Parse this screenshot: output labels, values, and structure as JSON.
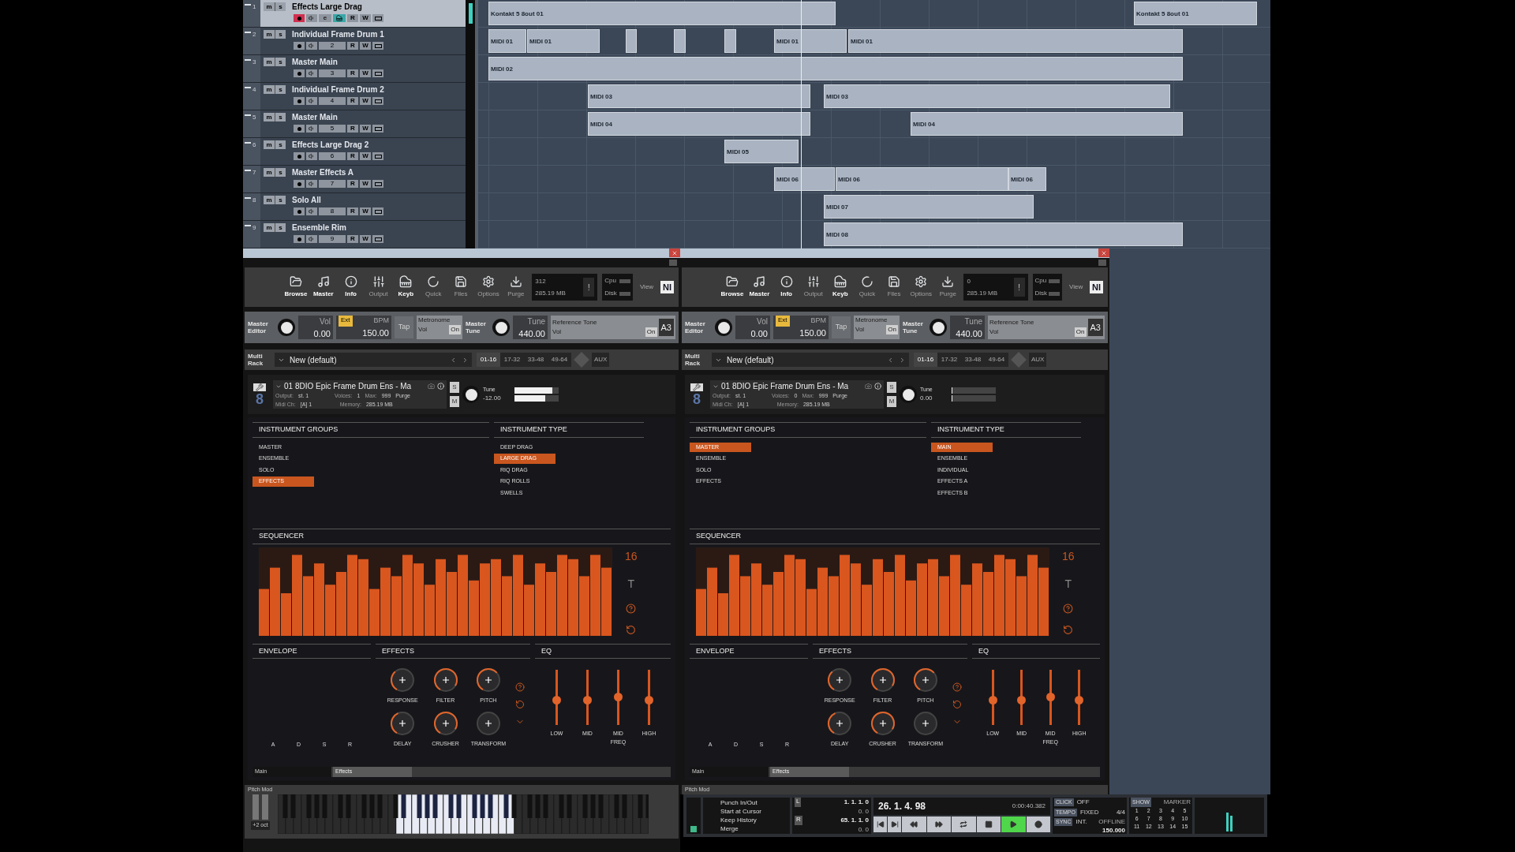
{
  "tracks": [
    {
      "number": "1",
      "name": "Effects Large Drag",
      "selected": true,
      "record": true,
      "kind": "instrument",
      "mute": "m",
      "solo": "s",
      "edit": "e",
      "read": "R",
      "write": "W"
    },
    {
      "number": "2",
      "name": "Individual Frame Drum 1",
      "selected": false,
      "record": false,
      "kind": "midi",
      "channel": "2",
      "mute": "m",
      "solo": "s",
      "read": "R",
      "write": "W"
    },
    {
      "number": "3",
      "name": "Master Main",
      "selected": false,
      "record": false,
      "kind": "midi",
      "channel": "3",
      "mute": "m",
      "solo": "s",
      "read": "R",
      "write": "W"
    },
    {
      "number": "4",
      "name": "Individual Frame Drum 2",
      "selected": false,
      "record": false,
      "kind": "midi",
      "channel": "4",
      "mute": "m",
      "solo": "s",
      "read": "R",
      "write": "W"
    },
    {
      "number": "5",
      "name": "Master Main",
      "selected": false,
      "record": false,
      "kind": "midi",
      "channel": "5",
      "mute": "m",
      "solo": "s",
      "read": "R",
      "write": "W"
    },
    {
      "number": "6",
      "name": "Effects Large Drag 2",
      "selected": false,
      "record": false,
      "kind": "midi",
      "channel": "6",
      "mute": "m",
      "solo": "s",
      "read": "R",
      "write": "W"
    },
    {
      "number": "7",
      "name": "Master Effects A",
      "selected": false,
      "record": false,
      "kind": "midi",
      "channel": "7",
      "mute": "m",
      "solo": "s",
      "read": "R",
      "write": "W"
    },
    {
      "number": "8",
      "name": "Solo All",
      "selected": false,
      "record": false,
      "kind": "midi",
      "channel": "8",
      "mute": "m",
      "solo": "s",
      "read": "R",
      "write": "W"
    },
    {
      "number": "9",
      "name": "Ensemble Rim",
      "selected": false,
      "record": false,
      "kind": "midi",
      "channel": "9",
      "mute": "m",
      "solo": "s",
      "read": "R",
      "write": "W"
    }
  ],
  "lanes": [
    {
      "clips": [
        {
          "kind": "named",
          "name": "Kontakt 5 8out 01"
        },
        {
          "kind": "named",
          "name": "Kontakt 5 8out 01"
        }
      ]
    },
    {
      "clips": [
        {
          "kind": "named",
          "name": "MIDI 01"
        },
        {
          "kind": "named",
          "name": "MIDI 01"
        },
        {
          "kind": "small"
        },
        {
          "kind": "small"
        },
        {
          "kind": "small"
        },
        {
          "kind": "named",
          "name": "MIDI 01"
        },
        {
          "kind": "named",
          "name": "MIDI 01"
        }
      ]
    },
    {
      "clips": [
        {
          "kind": "named",
          "name": "MIDI 02"
        }
      ]
    },
    {
      "clips": [
        {
          "kind": "named",
          "name": "MIDI 03"
        },
        {
          "kind": "named",
          "name": "MIDI 03"
        }
      ]
    },
    {
      "clips": [
        {
          "kind": "named",
          "name": "MIDI 04"
        },
        {
          "kind": "named",
          "name": "MIDI 04"
        }
      ]
    },
    {
      "clips": [
        {
          "kind": "named",
          "name": "MIDI 05"
        }
      ]
    },
    {
      "clips": [
        {
          "kind": "named",
          "name": "MIDI 06"
        },
        {
          "kind": "named",
          "name": "MIDI 06"
        },
        {
          "kind": "named",
          "name": "MIDI 06"
        }
      ]
    },
    {
      "clips": [
        {
          "kind": "named",
          "name": "MIDI 07"
        }
      ]
    },
    {
      "clips": [
        {
          "kind": "named",
          "name": "MIDI 08"
        }
      ]
    }
  ],
  "kontakt_windows": [
    {
      "toolbar": [
        {
          "label": "Browse",
          "kind": "folder",
          "disabled": false
        },
        {
          "label": "Master",
          "kind": "master",
          "disabled": false
        },
        {
          "label": "Info",
          "kind": "info",
          "disabled": false
        },
        {
          "label": "Output",
          "kind": "output",
          "disabled": true
        },
        {
          "label": "Keyb",
          "kind": "keyboard",
          "disabled": false
        },
        {
          "label": "Quick",
          "kind": "quick",
          "disabled": true
        },
        {
          "label": "Files",
          "kind": "files",
          "disabled": true
        },
        {
          "label": "Options",
          "kind": "options",
          "disabled": true
        },
        {
          "label": "Purge",
          "kind": "purge",
          "disabled": true
        }
      ],
      "status": {
        "voices": "312",
        "memory": "285.19 MB",
        "alert": "!"
      },
      "cpu": "Cpu",
      "disk": "Disk",
      "view": "View",
      "logo": "NI",
      "master": {
        "editor": "Master Editor",
        "vol_label": "Vol",
        "vol": "0.00",
        "ext": "Ext",
        "bpm_label": "BPM",
        "bpm": "150.00",
        "tap": "Tap",
        "metronome": "Metronome",
        "metro_on": "On",
        "metro_vol": "Vol",
        "tune_section": "Master Tune",
        "tune_label": "Tune",
        "tune": "440.00",
        "ref_tone": "Reference Tone",
        "ref_vol": "Vol",
        "ref_on": "On",
        "ref_note": "A3"
      },
      "rack": {
        "label": "Multi Rack",
        "preset": "New (default)",
        "pages": [
          {
            "label": "01-16",
            "selected": true
          },
          {
            "label": "17-32",
            "selected": false
          },
          {
            "label": "33-48",
            "selected": false
          },
          {
            "label": "49-64",
            "selected": false
          }
        ],
        "aux": "AUX"
      },
      "instrument": {
        "slot": "8",
        "name": "01 8DIO Epic Frame Drum Ens - Ma",
        "output_label": "Output:",
        "output": "st. 1",
        "voices_label": "Voices:",
        "voices": "1",
        "max_label": "Max:",
        "max": "999",
        "purge": "Purge",
        "midi_label": "Midi Ch:",
        "midi": "[A] 1",
        "memory_label": "Memory:",
        "memory": "285.19 MB",
        "solo": "S",
        "mute": "M",
        "tune_label": "Tune",
        "tune": "-12.00",
        "meters": [
          {
            "level": 0.85
          },
          {
            "level": 0.7
          }
        ]
      },
      "groups": {
        "title": "INSTRUMENT GROUPS",
        "items": [
          {
            "label": "MASTER",
            "selected": false
          },
          {
            "label": "ENSEMBLE",
            "selected": false
          },
          {
            "label": "SOLO",
            "selected": false
          },
          {
            "label": "EFFECTS",
            "selected": true
          }
        ]
      },
      "types": {
        "title": "INSTRUMENT TYPE",
        "items": [
          {
            "label": "DEEP DRAG",
            "selected": false
          },
          {
            "label": "LARGE DRAG",
            "selected": true
          },
          {
            "label": "RIQ DRAG",
            "selected": false
          },
          {
            "label": "RIQ ROLLS",
            "selected": false
          },
          {
            "label": "SWELLS",
            "selected": false
          }
        ]
      },
      "sequencer": {
        "title": "SEQUENCER",
        "steps": "16",
        "mode": "T"
      },
      "envelope": {
        "title": "ENVELOPE",
        "labels": [
          "A",
          "D",
          "S",
          "R"
        ]
      },
      "effects": {
        "title": "EFFECTS",
        "knobs": [
          {
            "label": "RESPONSE"
          },
          {
            "label": "FILTER"
          },
          {
            "label": "PITCH"
          },
          {
            "label": "DELAY"
          },
          {
            "label": "CRUSHER"
          },
          {
            "label": "TRANSFORM"
          }
        ]
      },
      "eq": {
        "title": "EQ",
        "bands": [
          {
            "label": "LOW",
            "level": 0.45
          },
          {
            "label": "MID",
            "level": 0.45
          },
          {
            "label": "MID FREQ",
            "level": 0.5
          },
          {
            "label": "HIGH",
            "level": 0.45
          }
        ]
      },
      "tabs": [
        {
          "label": "Main",
          "selected": true
        },
        {
          "label": "Effects",
          "selected": false
        }
      ],
      "keyboard": {
        "label": "Pitch Mod",
        "octave": "+2 oct"
      }
    },
    {
      "toolbar": [
        {
          "label": "Browse",
          "kind": "folder",
          "disabled": false
        },
        {
          "label": "Master",
          "kind": "master",
          "disabled": false
        },
        {
          "label": "Info",
          "kind": "info",
          "disabled": false
        },
        {
          "label": "Output",
          "kind": "output",
          "disabled": true
        },
        {
          "label": "Keyb",
          "kind": "keyboard",
          "disabled": false
        },
        {
          "label": "Quick",
          "kind": "quick",
          "disabled": true
        },
        {
          "label": "Files",
          "kind": "files",
          "disabled": true
        },
        {
          "label": "Options",
          "kind": "options",
          "disabled": true
        },
        {
          "label": "Purge",
          "kind": "purge",
          "disabled": true
        }
      ],
      "status": {
        "voices": "0",
        "memory": "285.19 MB",
        "alert": "!"
      },
      "cpu": "Cpu",
      "disk": "Disk",
      "view": "View",
      "logo": "NI",
      "master": {
        "editor": "Master Editor",
        "vol_label": "Vol",
        "vol": "0.00",
        "ext": "Ext",
        "bpm_label": "BPM",
        "bpm": "150.00",
        "tap": "Tap",
        "metronome": "Metronome",
        "metro_on": "On",
        "metro_vol": "Vol",
        "tune_section": "Master Tune",
        "tune_label": "Tune",
        "tune": "440.00",
        "ref_tone": "Reference Tone",
        "ref_vol": "Vol",
        "ref_on": "On",
        "ref_note": "A3"
      },
      "rack": {
        "label": "Multi Rack",
        "preset": "New (default)",
        "pages": [
          {
            "label": "01-16",
            "selected": true
          },
          {
            "label": "17-32",
            "selected": false
          },
          {
            "label": "33-48",
            "selected": false
          },
          {
            "label": "49-64",
            "selected": false
          }
        ],
        "aux": "AUX"
      },
      "instrument": {
        "slot": "8",
        "name": "01 8DIO Epic Frame Drum Ens - Ma",
        "output_label": "Output:",
        "output": "st. 1",
        "voices_label": "Voices:",
        "voices": "0",
        "max_label": "Max:",
        "max": "999",
        "purge": "Purge",
        "midi_label": "Midi Ch:",
        "midi": "[A] 1",
        "memory_label": "Memory:",
        "memory": "285.19 MB",
        "solo": "S",
        "mute": "M",
        "tune_label": "Tune",
        "tune": "0.00",
        "meters": [
          {
            "level": 0
          },
          {
            "level": 0
          }
        ]
      },
      "groups": {
        "title": "INSTRUMENT GROUPS",
        "items": [
          {
            "label": "MASTER",
            "selected": true
          },
          {
            "label": "ENSEMBLE",
            "selected": false
          },
          {
            "label": "SOLO",
            "selected": false
          },
          {
            "label": "EFFECTS",
            "selected": false
          }
        ]
      },
      "types": {
        "title": "INSTRUMENT TYPE",
        "items": [
          {
            "label": "MAIN",
            "selected": true
          },
          {
            "label": "ENSEMBLE",
            "selected": false
          },
          {
            "label": "INDIVIDUAL",
            "selected": false
          },
          {
            "label": "EFFECTS A",
            "selected": false
          },
          {
            "label": "EFFECTS B",
            "selected": false
          }
        ]
      },
      "sequencer": {
        "title": "SEQUENCER",
        "steps": "16",
        "mode": "T"
      },
      "envelope": {
        "title": "ENVELOPE",
        "labels": [
          "A",
          "D",
          "S",
          "R"
        ]
      },
      "effects": {
        "title": "EFFECTS",
        "knobs": [
          {
            "label": "RESPONSE"
          },
          {
            "label": "FILTER"
          },
          {
            "label": "PITCH"
          },
          {
            "label": "DELAY"
          },
          {
            "label": "CRUSHER"
          },
          {
            "label": "TRANSFORM"
          }
        ]
      },
      "eq": {
        "title": "EQ",
        "bands": [
          {
            "label": "LOW",
            "level": 0.45
          },
          {
            "label": "MID",
            "level": 0.45
          },
          {
            "label": "MID FREQ",
            "level": 0.5
          },
          {
            "label": "HIGH",
            "level": 0.45
          }
        ]
      },
      "tabs": [
        {
          "label": "Main",
          "selected": true
        },
        {
          "label": "Effects",
          "selected": false
        }
      ],
      "keyboard": {
        "label": "Pitch Mod"
      }
    }
  ],
  "transport": {
    "punch": [
      "Punch In/Out",
      "Start at Cursor",
      "Keep History",
      "Merge"
    ],
    "left_locator": {
      "label": "L",
      "position": "1. 1. 1. 0",
      "offset": "0. 0"
    },
    "right_locator": {
      "label": "R",
      "position": "65. 1. 1. 0",
      "offset": "0. 0"
    },
    "position": "26. 1. 4. 98",
    "time": "0:00:40.382",
    "buttons": [
      {
        "kind": "start",
        "on": false
      },
      {
        "kind": "end",
        "on": false
      },
      {
        "kind": "rewind",
        "on": false
      },
      {
        "kind": "forward",
        "on": false
      },
      {
        "kind": "cycle",
        "on": false
      },
      {
        "kind": "stop",
        "on": false
      },
      {
        "kind": "play",
        "on": true
      },
      {
        "kind": "record",
        "on": false
      }
    ],
    "click": {
      "label": "CLICK",
      "value": "OFF"
    },
    "tempo": {
      "label": "TEMPO",
      "value": "FIXED",
      "signature": "4/4",
      "bpm": "150.000"
    },
    "sync": {
      "label": "SYNC",
      "value": "INT.",
      "status": "OFFLINE"
    },
    "markers": {
      "show": "SHOW",
      "label": "MARKER",
      "numbers": [
        "1",
        "2",
        "3",
        "4",
        "5",
        "6",
        "7",
        "8",
        "9",
        "10",
        "11",
        "12",
        "13",
        "14",
        "15"
      ]
    }
  }
}
